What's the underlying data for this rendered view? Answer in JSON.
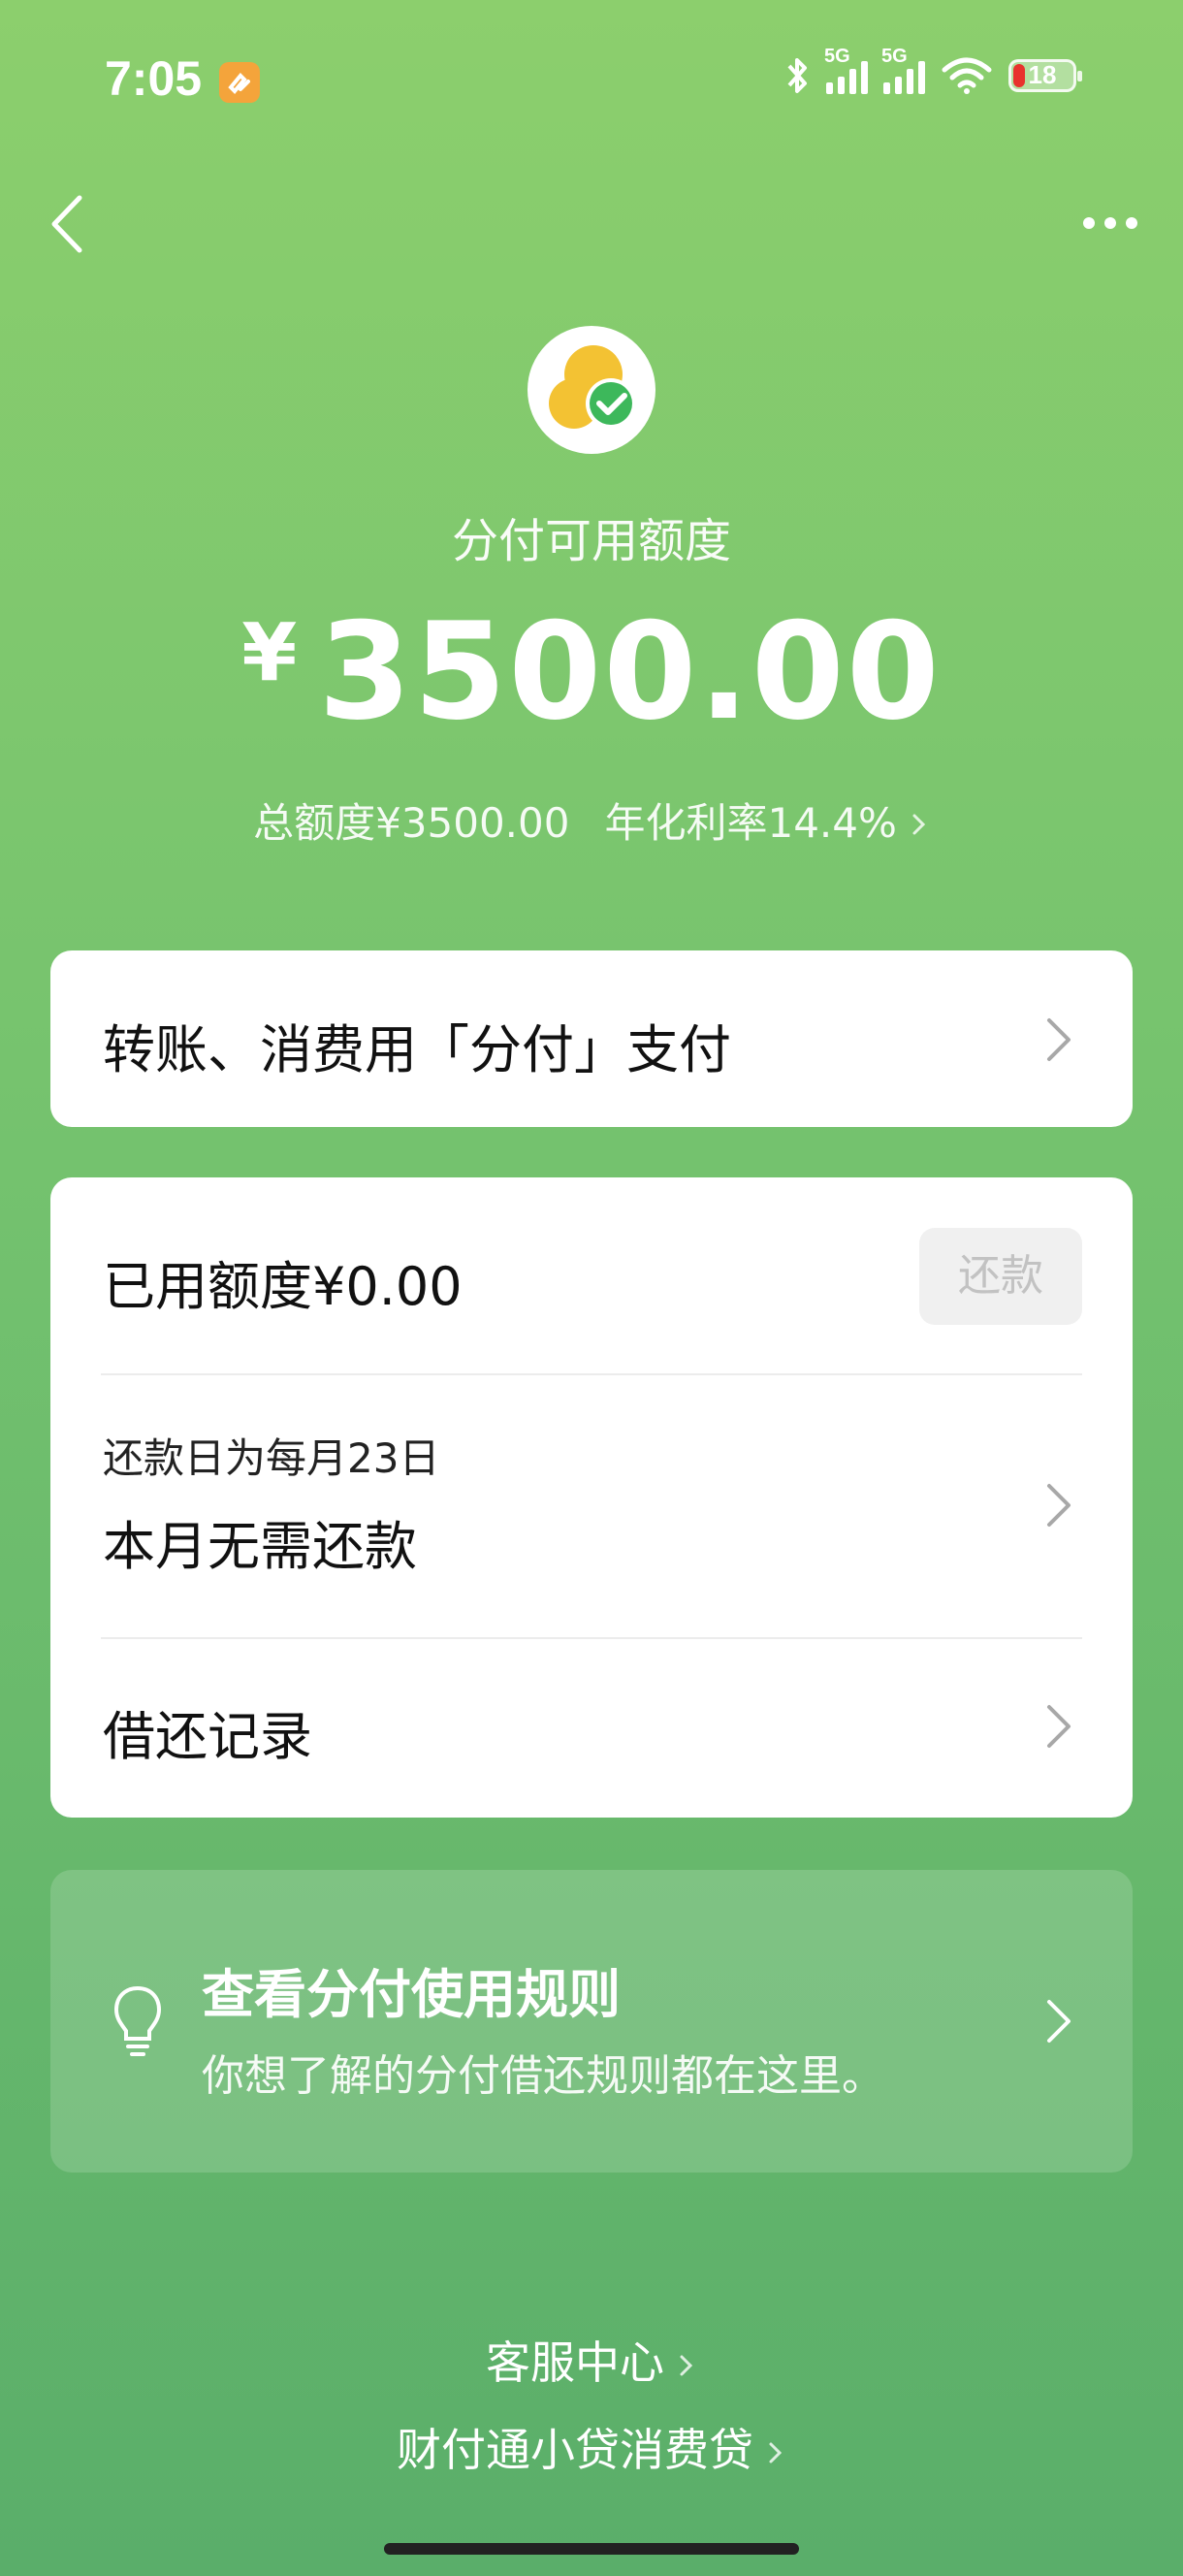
{
  "status_bar": {
    "time": "7:05",
    "network_1": "5G",
    "network_2": "5G",
    "battery": "18"
  },
  "header": {
    "subtitle": "分付可用额度",
    "currency": "¥",
    "amount": "3500.00",
    "total_limit": "总额度¥3500.00",
    "annual_rate": "年化利率14.4%"
  },
  "pay_card": {
    "label": "转账、消费用「分付」支付"
  },
  "usage_card": {
    "used_label": "已用额度¥0.00",
    "repay_button": "还款",
    "repay_day": "还款日为每月23日",
    "repay_status": "本月无需还款",
    "records": "借还记录"
  },
  "rules_card": {
    "title": "查看分付使用规则",
    "subtitle": "你想了解的分付借还规则都在这里。"
  },
  "footer": {
    "service": "客服中心",
    "lender": "财付通小贷消费贷"
  },
  "colors": {
    "accent_green": "#74c26e",
    "logo_yellow": "#f3c233",
    "logo_green": "#3db85b"
  }
}
